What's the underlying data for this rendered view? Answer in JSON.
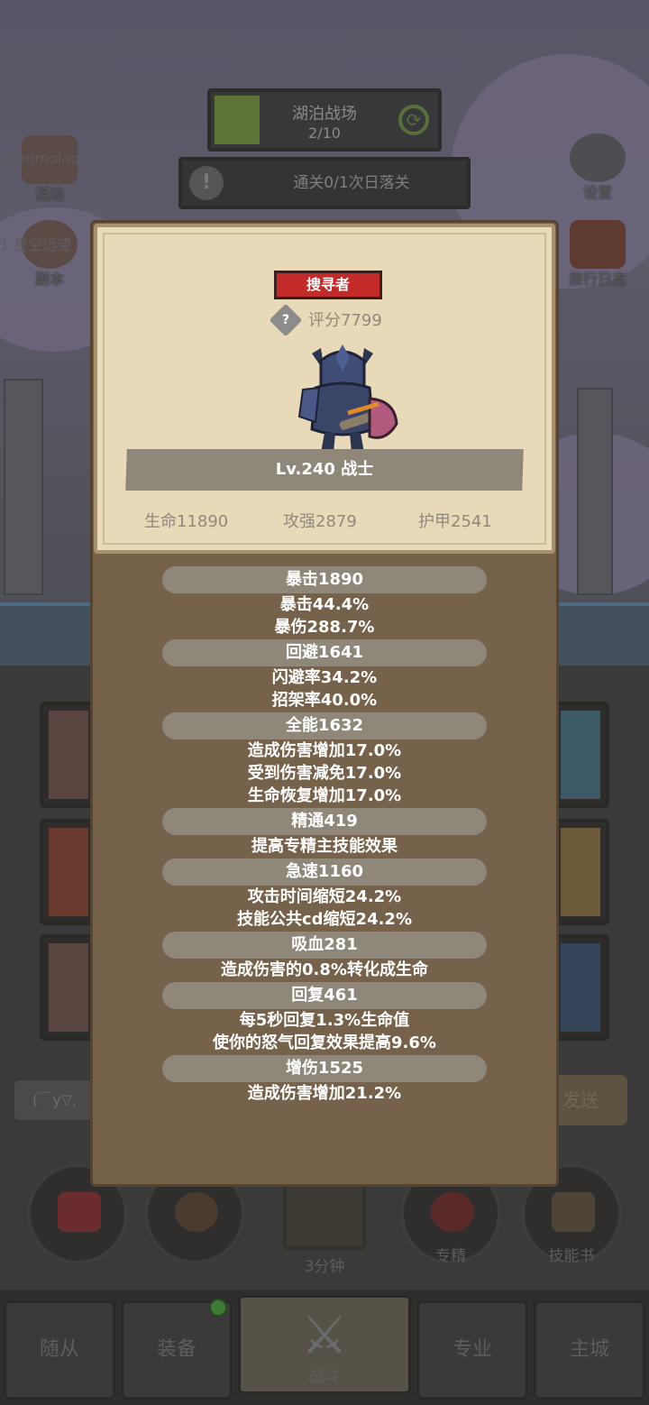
{
  "stage": {
    "title": "湖泊战场",
    "progress_text": "2/10",
    "progress": 0.2,
    "clear_text": "通关0/1次日落关"
  },
  "left_buttons": {
    "activity": "活动",
    "dungeon": "副本",
    "username": "shenmolao",
    "server_text": "1 星空远望"
  },
  "right_buttons": {
    "settings": "设置",
    "travel_log": "旅行日志"
  },
  "chat": {
    "placeholder": "(￣y▽,",
    "send": "发送"
  },
  "bottom_actions": {
    "chest_timer": "3分钟",
    "specialize": "专精",
    "skill_book": "技能书"
  },
  "nav": {
    "followers": "随从",
    "equipment": "装备",
    "battle": "战斗",
    "profession": "专业",
    "main_city": "主城"
  },
  "card": {
    "rank": "搜寻者",
    "score": "评分7799",
    "level_class": "Lv.240 战士",
    "hp": "生命11890",
    "attack": "攻强2879",
    "armor": "护甲2541"
  },
  "stats": [
    {
      "title": "暴击1890",
      "lines": [
        "暴击44.4%",
        "暴伤288.7%"
      ]
    },
    {
      "title": "回避1641",
      "lines": [
        "闪避率34.2%",
        "招架率40.0%"
      ]
    },
    {
      "title": "全能1632",
      "lines": [
        "造成伤害增加17.0%",
        "受到伤害减免17.0%",
        "生命恢复增加17.0%"
      ]
    },
    {
      "title": "精通419",
      "lines": [
        "提高专精主技能效果"
      ]
    },
    {
      "title": "急速1160",
      "lines": [
        "攻击时间缩短24.2%",
        "技能公共cd缩短24.2%"
      ]
    },
    {
      "title": "吸血281",
      "lines": [
        "造成伤害的0.8%转化成生命"
      ]
    },
    {
      "title": "回复461",
      "lines": [
        "每5秒回复1.3%生命值",
        "使你的怒气回复效果提高9.6%"
      ]
    },
    {
      "title": "增伤1525",
      "lines": [
        "造成伤害增加21.2%"
      ]
    }
  ],
  "colors": {
    "rank_red": "#c32a2a",
    "card_paper": "#e8d9b8",
    "panel_brown": "#76624b",
    "pill": "#8f8779"
  }
}
